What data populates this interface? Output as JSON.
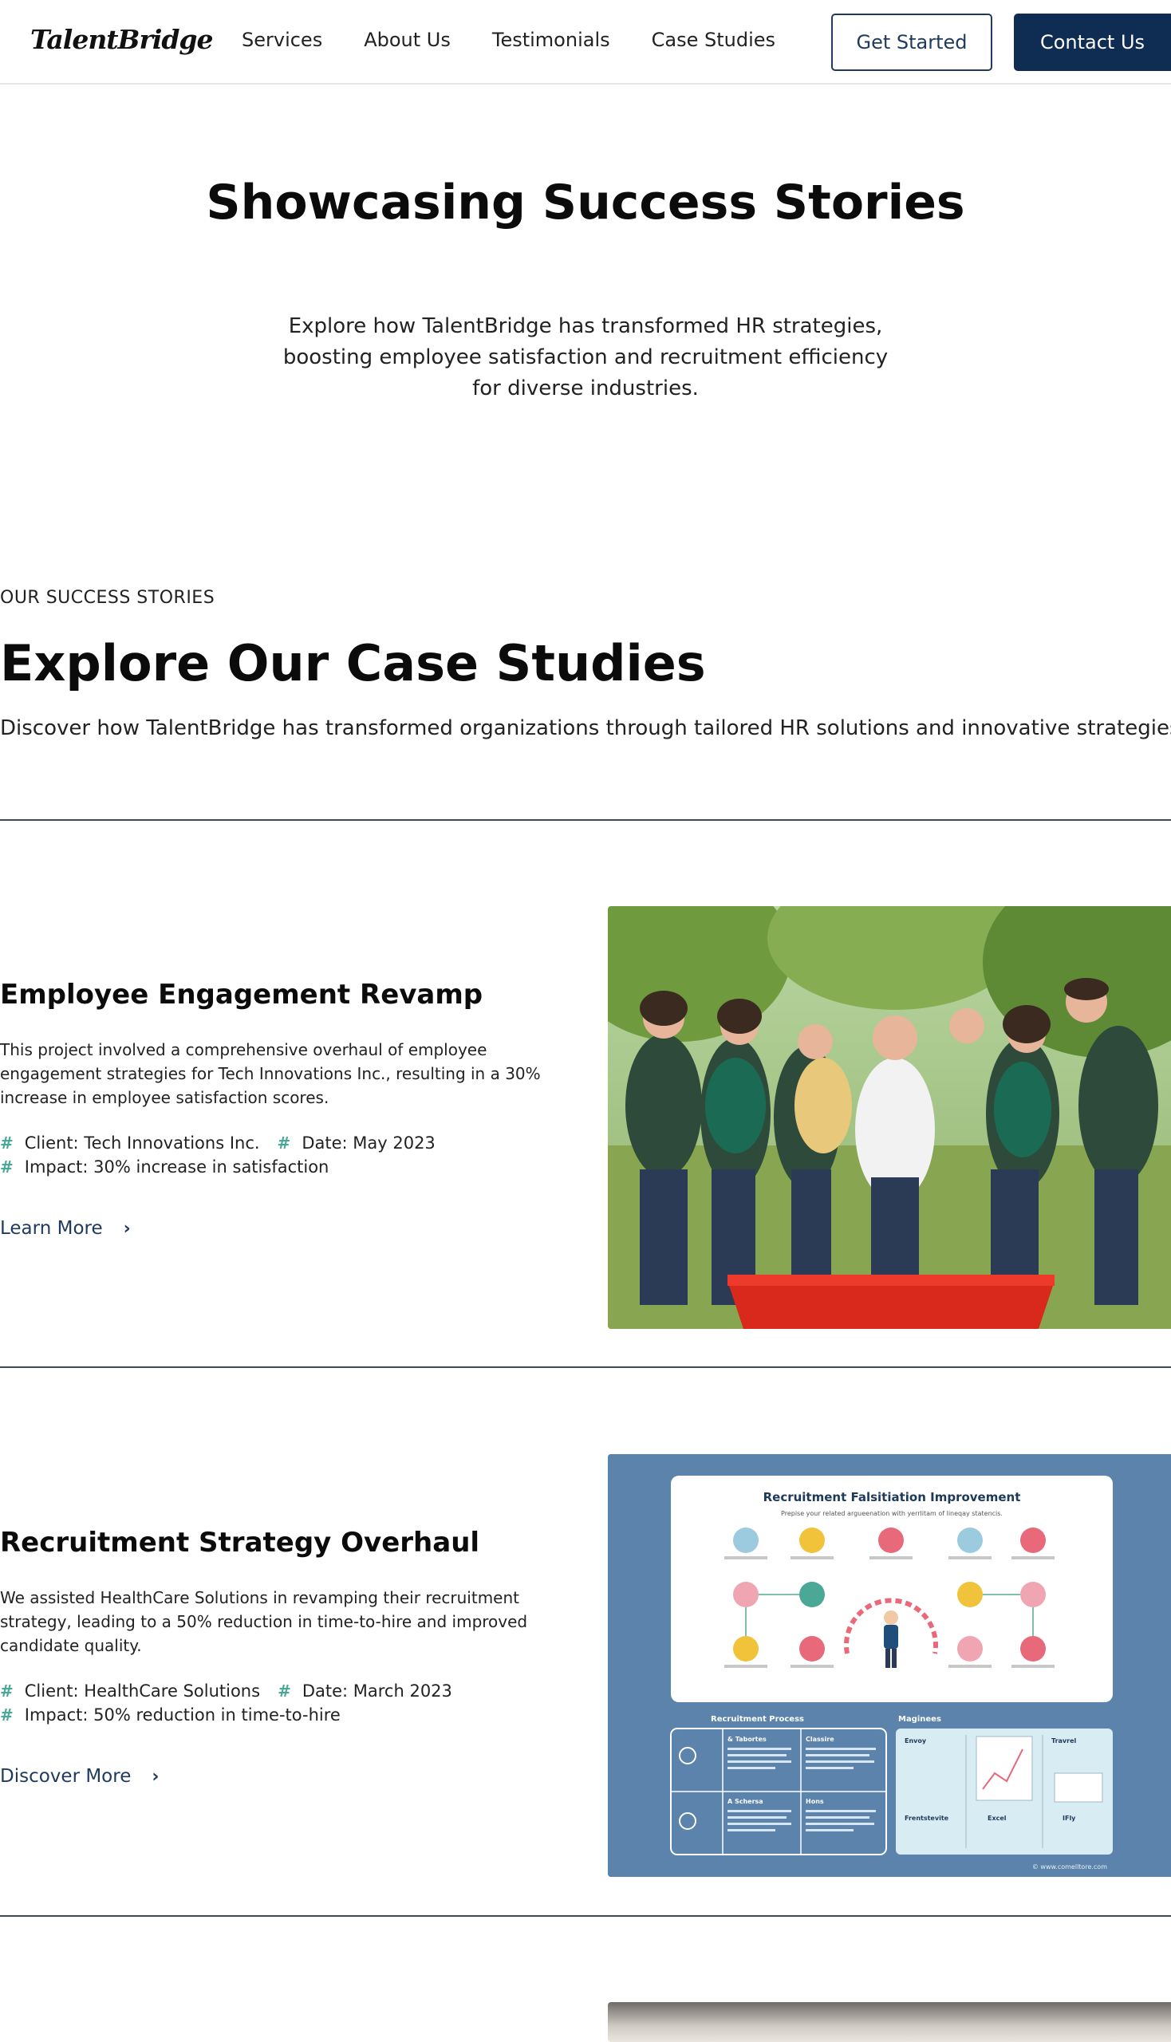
{
  "nav": {
    "logo": "TalentBridge",
    "links": [
      "Services",
      "About Us",
      "Testimonials",
      "Case Studies"
    ],
    "get_started": "Get Started",
    "contact": "Contact Us"
  },
  "hero": {
    "title": "Showcasing Success Stories",
    "subtitle": "Explore how TalentBridge has transformed HR strategies, boosting employee satisfaction and recruitment efficiency for diverse industries."
  },
  "section": {
    "eyebrow": "OUR SUCCESS STORIES",
    "title": "Explore Our Case Studies",
    "subtitle": "Discover how TalentBridge has transformed organizations through tailored HR solutions and innovative strategies."
  },
  "cases": [
    {
      "title": "Employee Engagement Revamp",
      "description": "This project involved a comprehensive overhaul of employee engagement strategies for Tech Innovations Inc., resulting in a 30% increase in employee satisfaction scores.",
      "client": "Client: Tech Innovations Inc.",
      "date": "Date: May 2023",
      "impact": "Impact: 30% increase in satisfaction",
      "link": "Learn More"
    },
    {
      "title": "Recruitment Strategy Overhaul",
      "description": "We assisted HealthCare Solutions in revamping their recruitment strategy, leading to a 50% reduction in time-to-hire and improved candidate quality.",
      "client": "Client: HealthCare Solutions",
      "date": "Date: March 2023",
      "impact": "Impact: 50% reduction in time-to-hire",
      "link": "Discover More"
    }
  ],
  "infographic": {
    "title": "Recruitment Falsitiation Improvement",
    "subtitle": "Prepise your related argueenation with yerrlitam of lineqay statencis.",
    "process_label": "Recruitment Process",
    "magines_label": "Maginees",
    "process_cells": [
      "& Tabortes",
      "Classire",
      "A Schersa",
      "Hons"
    ],
    "magines_cells": [
      "Envoy",
      "Travrel",
      "Frentstevite",
      "Excel",
      "IFly"
    ],
    "footer": "© www.comelltore.com"
  }
}
